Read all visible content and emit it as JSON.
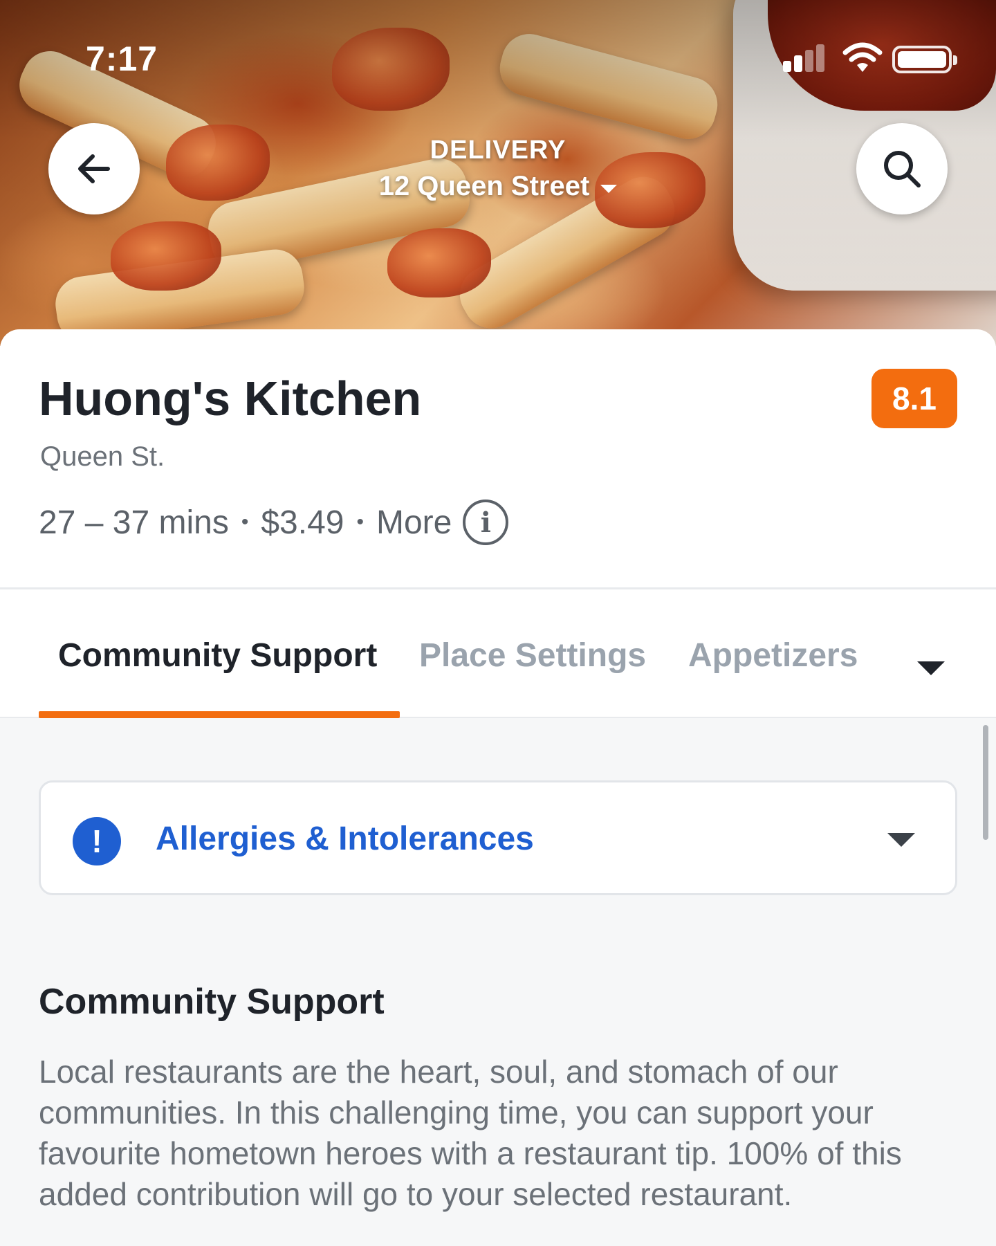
{
  "status_bar": {
    "time": "7:17"
  },
  "header": {
    "mode_label": "DELIVERY",
    "address": "12 Queen Street",
    "back_icon": "arrow-left-icon",
    "search_icon": "search-icon"
  },
  "restaurant": {
    "name": "Huong's Kitchen",
    "rating": "8.1",
    "location": "Queen St.",
    "delivery_time": "27 – 37 mins",
    "delivery_fee": "$3.49",
    "more_label": "More",
    "separator": "•"
  },
  "tabs": [
    {
      "label": "Community Support",
      "active": true
    },
    {
      "label": "Place Settings",
      "active": false
    },
    {
      "label": "Appetizers",
      "active": false
    }
  ],
  "allergies": {
    "label": "Allergies & Intolerances",
    "icon": "exclamation"
  },
  "community_section": {
    "heading": "Community Support",
    "body": "Local restaurants are the heart, soul, and stomach of our communities. In this challenging time, you can support your favourite hometown heroes with a restaurant tip. 100% of this added contribution will go to your selected restaurant."
  },
  "colors": {
    "accent_orange": "#f36d0f",
    "link_blue": "#1f5fd1",
    "text_dark": "#1f232a",
    "text_muted": "#6b7178",
    "tab_inactive": "#9aa3ad"
  }
}
